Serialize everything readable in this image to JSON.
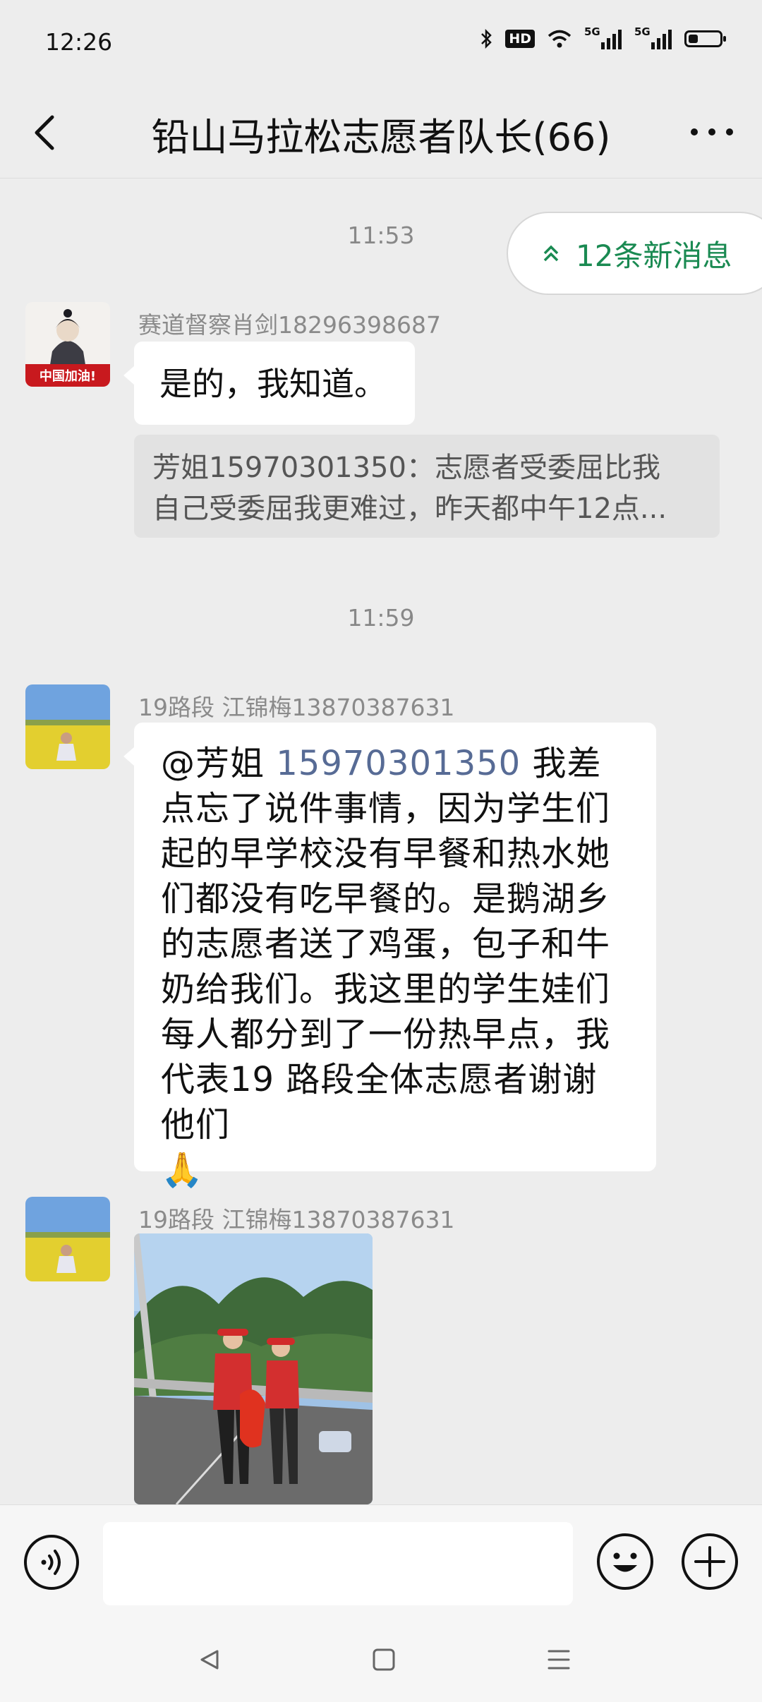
{
  "status_bar": {
    "time": "12:26",
    "hd_label": "HD",
    "signal_1": "5G",
    "signal_2": "5G",
    "battery_level": 0.3
  },
  "header": {
    "title": "铅山马拉松志愿者队长(66)"
  },
  "new_messages": {
    "label": "12条新消息",
    "accent_color": "#1a8a52"
  },
  "messages": [
    {
      "type": "time",
      "text": "11:53"
    },
    {
      "type": "text",
      "sender": "赛道督察肖剑18296398687",
      "avatar_caption": "中国加油!",
      "text": "是的，我知道。"
    },
    {
      "type": "quote",
      "line1": "芳姐15970301350：志愿者受委屈比我",
      "line2": "自己受委屈我更难过，昨天都中午12点..."
    },
    {
      "type": "time",
      "text": "11:59"
    },
    {
      "type": "text",
      "sender": "19路段  江锦梅13870387631",
      "mention_at": "@芳姐 ",
      "mention_phone": "15970301350",
      "text": " 我差点忘了说件事情，因为学生们起的早学校没有早餐和热水她们都没有吃早餐的。是鹅湖乡的志愿者送了鸡蛋，包子和牛奶给我们。我这里的学生娃们每人都分到了一份热早点，我代表19 路段全体志愿者谢谢他们",
      "emoji": "🙏"
    },
    {
      "type": "image",
      "sender": "19路段  江锦梅13870387631"
    }
  ]
}
